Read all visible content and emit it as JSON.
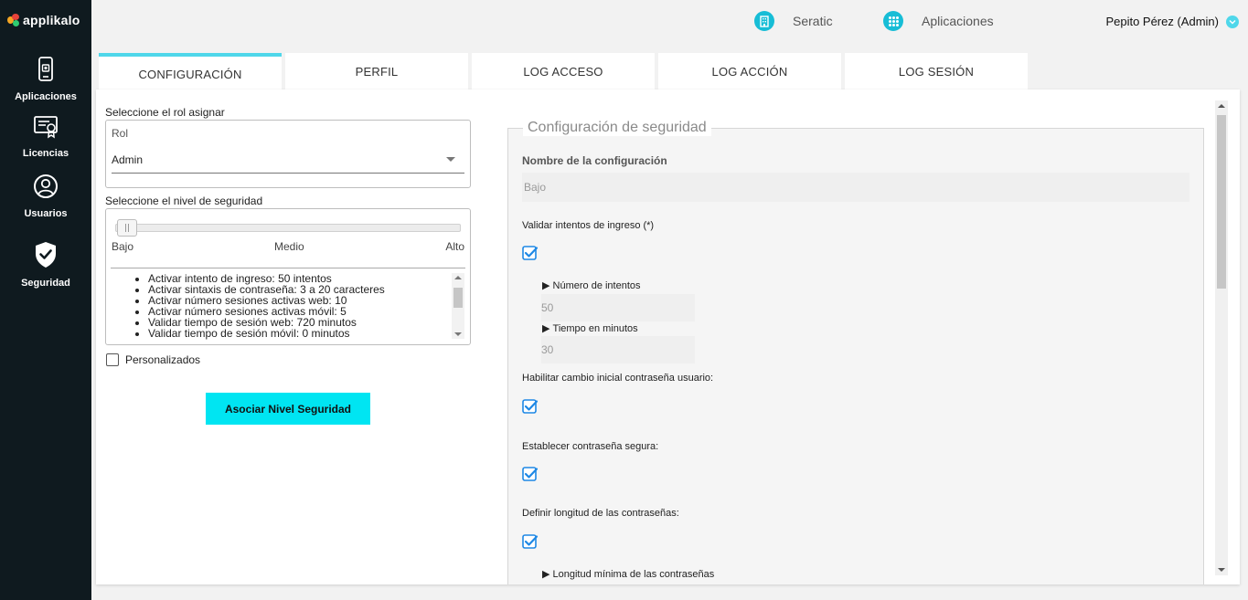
{
  "app": {
    "brand": "applikalo"
  },
  "sidebar": {
    "items": [
      {
        "label": "Aplicaciones",
        "icon": "phone-icon"
      },
      {
        "label": "Licencias",
        "icon": "certificate-icon"
      },
      {
        "label": "Usuarios",
        "icon": "user-circle-icon"
      },
      {
        "label": "Seguridad",
        "icon": "shield-check-icon"
      }
    ]
  },
  "header": {
    "company": "Seratic",
    "apps": "Aplicaciones",
    "user": "Pepito Pérez (Admin)"
  },
  "tabs": [
    {
      "label": "CONFIGURACIÓN",
      "active": true
    },
    {
      "label": "PERFIL",
      "active": false
    },
    {
      "label": "LOG ACCESO",
      "active": false
    },
    {
      "label": "LOG ACCIÓN",
      "active": false
    },
    {
      "label": "LOG SESIÓN",
      "active": false
    }
  ],
  "left": {
    "role_prompt": "Seleccione el rol asignar",
    "role_label": "Rol",
    "role_value": "Admin",
    "level_prompt": "Seleccione el nivel de seguridad",
    "slider": {
      "low": "Bajo",
      "mid": "Medio",
      "high": "Alto",
      "value": 0
    },
    "rules": [
      "Activar intento de ingreso: 50 intentos",
      "Activar sintaxis de contraseña: 3 a 20 caracteres",
      "Activar número sesiones activas web: 10",
      "Activar número sesiones activas móvil: 5",
      "Validar tiempo de sesión web: 720 minutos",
      "Validar tiempo de sesión móvil: 0 minutos"
    ],
    "custom_label": "Personalizados",
    "custom_checked": false,
    "associate_button": "Asociar Nivel Seguridad"
  },
  "right": {
    "legend": "Configuración de seguridad",
    "config_name_label": "Nombre de la configuración",
    "config_name_value": "Bajo",
    "validate_attempts_label": "Validar intentos de ingreso (*)",
    "attempts_label": "Número de intentos",
    "attempts_value": "50",
    "minutes_label": "Tiempo en minutos",
    "minutes_value": "30",
    "initial_change_label": "Habilitar cambio inicial contraseña usuario:",
    "secure_password_label": "Establecer contraseña segura:",
    "length_label": "Definir longitud de las contraseñas:",
    "min_length_label": "Longitud mínima de las contraseñas"
  },
  "colors": {
    "sidebar_bg": "#0f1a1f",
    "accent": "#4fd7ea",
    "button": "#00e5f2",
    "check": "#1e88e5"
  }
}
